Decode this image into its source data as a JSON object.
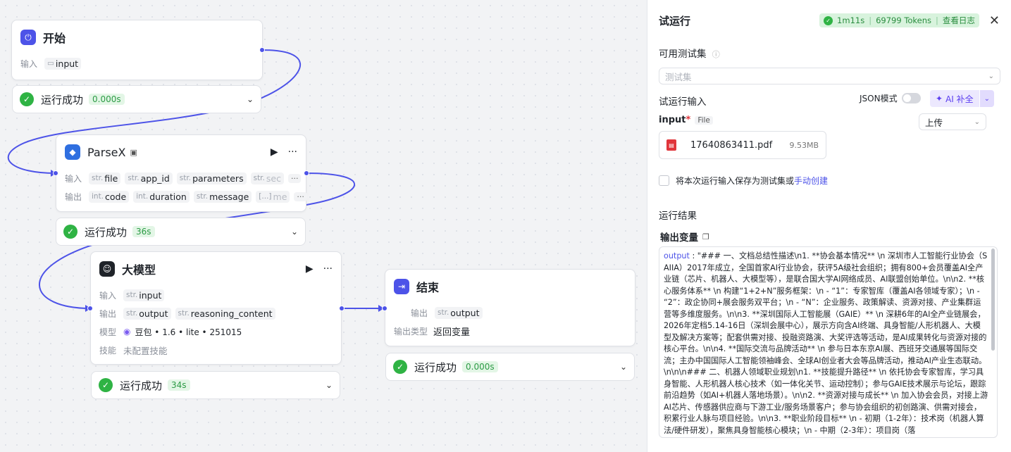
{
  "start_node": {
    "title": "开始",
    "input_label": "输入",
    "input_var": "input",
    "status": "运行成功",
    "duration": "0.000s"
  },
  "parsex_node": {
    "title": "ParseX",
    "input_label": "输入",
    "output_label": "输出",
    "inputs": [
      {
        "type": "str.",
        "name": "file"
      },
      {
        "type": "str.",
        "name": "app_id"
      },
      {
        "type": "str.",
        "name": "parameters"
      },
      {
        "type": "str.",
        "name": "sec"
      }
    ],
    "outputs": [
      {
        "type": "int.",
        "name": "code"
      },
      {
        "type": "int.",
        "name": "duration"
      },
      {
        "type": "str.",
        "name": "message"
      },
      {
        "type": "[...]",
        "name": "me"
      }
    ],
    "more": "···",
    "status": "运行成功",
    "duration": "36s"
  },
  "llm_node": {
    "title": "大模型",
    "input_label": "输入",
    "output_label": "输出",
    "model_label": "模型",
    "skill_label": "技能",
    "inputs": [
      {
        "type": "str.",
        "name": "input"
      }
    ],
    "outputs": [
      {
        "type": "str.",
        "name": "output"
      },
      {
        "type": "str.",
        "name": "reasoning_content"
      }
    ],
    "model": "豆包 • 1.6 • lite • 251015",
    "skill": "未配置技能",
    "status": "运行成功",
    "duration": "34s"
  },
  "end_node": {
    "title": "结束",
    "output_label": "输出",
    "output_type_label": "输出类型",
    "outputs": [
      {
        "type": "str.",
        "name": "output"
      }
    ],
    "output_type": "返回变量",
    "status": "运行成功",
    "duration": "0.000s"
  },
  "panel": {
    "title": "试运行",
    "run_time": "1m11s",
    "tokens": "69799 Tokens",
    "view_log": "查看日志",
    "testset_label": "可用测试集",
    "testset_placeholder": "测试集",
    "run_input_label": "试运行输入",
    "json_mode_label": "JSON模式",
    "ai_fill_label": "AI 补全",
    "input_name": "input",
    "required_mark": "*",
    "input_type": "File",
    "upload_label": "上传",
    "file_name": "17640863411.pdf",
    "file_size": "9.53MB",
    "save_checkbox_label": "将本次运行输入保存为测试集或",
    "manual_create_link": "手动创建",
    "result_label": "运行结果",
    "output_var_label": "输出变量",
    "output_key": "output",
    "output_value": " : \"### 一、文档总结性描述\\n1. **协会基本情况** \\n  深圳市人工智能行业协会（SAIIA）2017年成立，全国首家AI行业协会，获评5A级社会组织；拥有800+会员覆盖AI全产业链（芯片、机器人、大模型等），是联合国大学AI网络成员、AI联盟创始单位。\\n\\n2. **核心服务体系** \\n  构建“1+2+N”服务框架：\\n  - “1”：专家智库（覆盖AI各领域专家）；\\n  - “2”：政企协同+展会服务双平台；\\n  - “N”：企业服务、政策解读、资源对接、产业集群运营等多维度服务。\\n\\n3. **深圳国际人工智能展（GAIE）** \\n  深耕6年的AI全产业链展会，2026年定档5.14-16日（深圳会展中心），展示方向含AI终端、具身智能/人形机器人、大模型及解决方案等；配套供需对接、投融资路演、大奖评选等活动，是AI成果转化与资源对接的核心平台。\\n\\n4. **国际交流与品牌活动** \\n  参与日本东京AI展、西班牙交通展等国际交流；主办中国国际人工智能领袖峰会、全球AI创业者大会等品牌活动，推动AI产业生态联动。\\n\\n\\n### 二、机器人领域职业规划\\n1. **技能提升路径** \\n  依托协会专家智库，学习具身智能、人形机器人核心技术（如一体化关节、运动控制）；参与GAIE技术展示与论坛，跟踪前沿趋势（如AI+机器人落地场景）。\\n\\n2. **资源对接与成长** \\n  加入协会会员，对接上游AI芯片、传感器供应商与下游工业/服务场景客户；参与协会组织的初创路演、供需对接会，积累行业人脉与项目经验。\\n\\n3. **职业阶段目标** \\n  - 初期（1-2年）：技术岗（机器人算法/硬件研发），聚焦具身智能核心模块；\\n  - 中期（2-3年）：项目岗（落"
  }
}
